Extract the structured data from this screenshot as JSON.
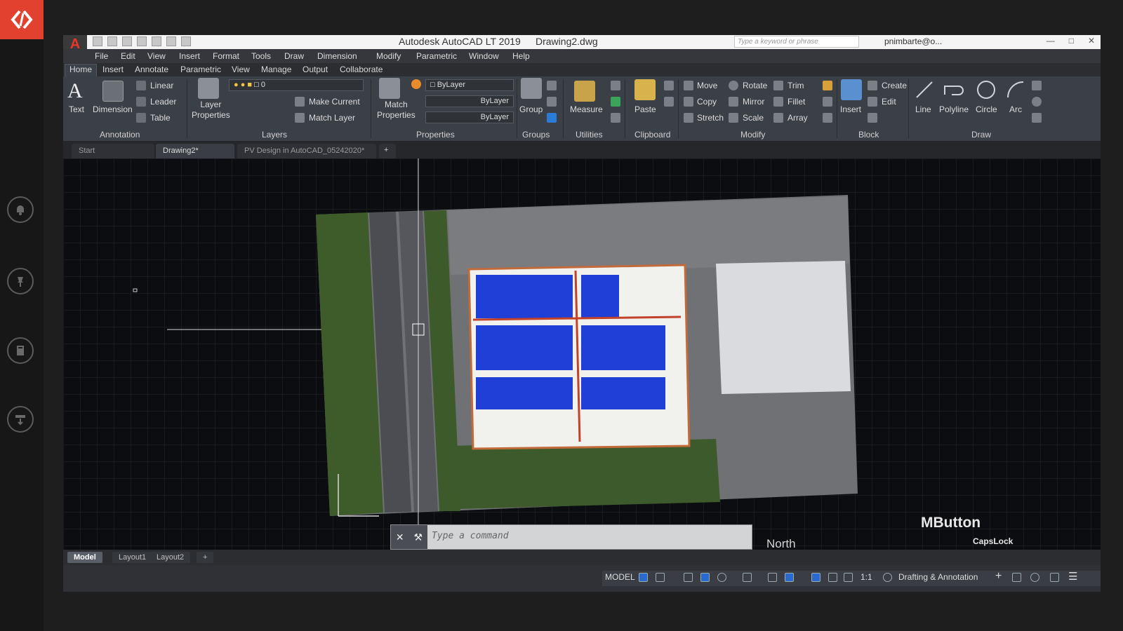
{
  "window": {
    "app_title": "Autodesk AutoCAD LT 2019",
    "file_title": "Drawing2.dwg",
    "search_placeholder": "Type a keyword or phrase",
    "user": "pnimbarte@o...",
    "app_button": "A"
  },
  "menu": [
    "File",
    "Edit",
    "View",
    "Insert",
    "Format",
    "Tools",
    "Draw",
    "Dimension",
    "Modify",
    "Parametric",
    "Window",
    "Help"
  ],
  "ribbon_tabs": [
    "Home",
    "Insert",
    "Annotate",
    "Parametric",
    "View",
    "Manage",
    "Output",
    "Collaborate"
  ],
  "ribbon": {
    "annotation": {
      "text": "Text",
      "dimension": "Dimension",
      "linear": "Linear",
      "leader": "Leader",
      "table": "Table",
      "panel": "Annotation"
    },
    "layers": {
      "layer_properties": "Layer\nProperties",
      "current_layer": "0",
      "make_current": "Make Current",
      "match_layer": "Match Layer",
      "panel": "Layers"
    },
    "properties": {
      "match_properties": "Match\nProperties",
      "color": "ByLayer",
      "linetype": "ByLayer",
      "lineweight": "ByLayer",
      "panel": "Properties"
    },
    "groups": {
      "group": "Group",
      "panel": "Groups"
    },
    "utilities": {
      "measure": "Measure",
      "panel": "Utilities"
    },
    "clipboard": {
      "paste": "Paste",
      "panel": "Clipboard"
    },
    "modify": {
      "move": "Move",
      "rotate": "Rotate",
      "trim": "Trim",
      "copy": "Copy",
      "mirror": "Mirror",
      "fillet": "Fillet",
      "stretch": "Stretch",
      "scale": "Scale",
      "array": "Array",
      "panel": "Modify"
    },
    "block": {
      "insert": "Insert",
      "create": "Create",
      "edit": "Edit",
      "panel": "Block"
    },
    "draw": {
      "line": "Line",
      "polyline": "Polyline",
      "circle": "Circle",
      "arc": "Arc",
      "panel": "Draw"
    }
  },
  "doc_tabs": [
    "Start",
    "Drawing2*",
    "PV Design in AutoCAD_05242020*"
  ],
  "command": {
    "placeholder": "Type a command"
  },
  "overlays": {
    "mbutton": "MButton",
    "capslock": "CapsLock",
    "north": "North"
  },
  "layout_tabs": [
    "Model",
    "Layout1",
    "Layout2"
  ],
  "status": {
    "model": "MODEL",
    "scale": "1:1",
    "workspace": "Drafting & Annotation"
  },
  "colors": {
    "accent_red": "#e2412f",
    "ribbon_bg": "#3b3f46",
    "panel_blue": "#1f3fd6",
    "canvas_bg": "#0c0d10"
  },
  "icons": [
    "bell-icon",
    "pin-icon",
    "book-icon",
    "tray-icon"
  ]
}
